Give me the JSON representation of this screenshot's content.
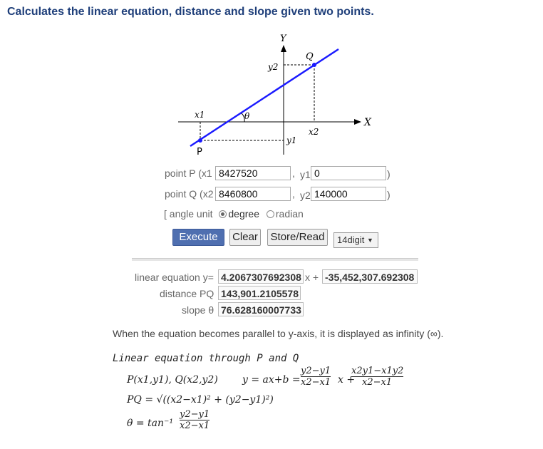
{
  "page": {
    "title": "Calculates the linear equation, distance and slope given two points."
  },
  "diagram": {
    "axis_x": "X",
    "axis_y": "Y",
    "p_label": "P",
    "q_label": "Q",
    "x1": "x1",
    "x2": "x2",
    "y1": "y1",
    "y2": "y2",
    "theta": "θ"
  },
  "form": {
    "point_p_label": "point P (x1",
    "point_q_label": "point Q (x2",
    "comma": ",",
    "y1_label": "y1",
    "y2_label": "y2",
    "close_paren": ")",
    "x1_value": "8427520",
    "y1_value": "0",
    "x2_value": "8460800",
    "y2_value": "140000",
    "angle_unit_label": "[ angle unit",
    "degree_label": "degree",
    "radian_label": "radian",
    "angle_unit_selected": "degree"
  },
  "buttons": {
    "execute": "Execute",
    "clear": "Clear",
    "store_read": "Store/Read",
    "digits": "14digit"
  },
  "results": {
    "linear_label": "linear equation y=",
    "slope_coef": "4.2067307692308",
    "x_plus": "x +",
    "intercept": "-35,452,307.692308",
    "distance_label": "distance PQ",
    "distance_value": "143,901.2105578",
    "slope_label": "slope θ",
    "slope_value": "76.628160007733"
  },
  "note": "When the equation becomes parallel to y-axis, it is displayed as infinity (∞).",
  "formulas": {
    "heading": "Linear equation through P and Q",
    "points": "P(x1,y1), Q(x2,y2)",
    "eq_prefix": "y = ax+b =",
    "frac1_num": "y2−y1",
    "frac1_den": "x2−x1",
    "x_plus": "x +",
    "frac2_num": "x2y1−x1y2",
    "frac2_den": "x2−x1",
    "pq": "PQ = √((x2−x1)² + (y2−y1)²)",
    "theta_prefix": "θ = tan⁻¹",
    "theta_num": "y2−y1",
    "theta_den": "x2−x1"
  }
}
